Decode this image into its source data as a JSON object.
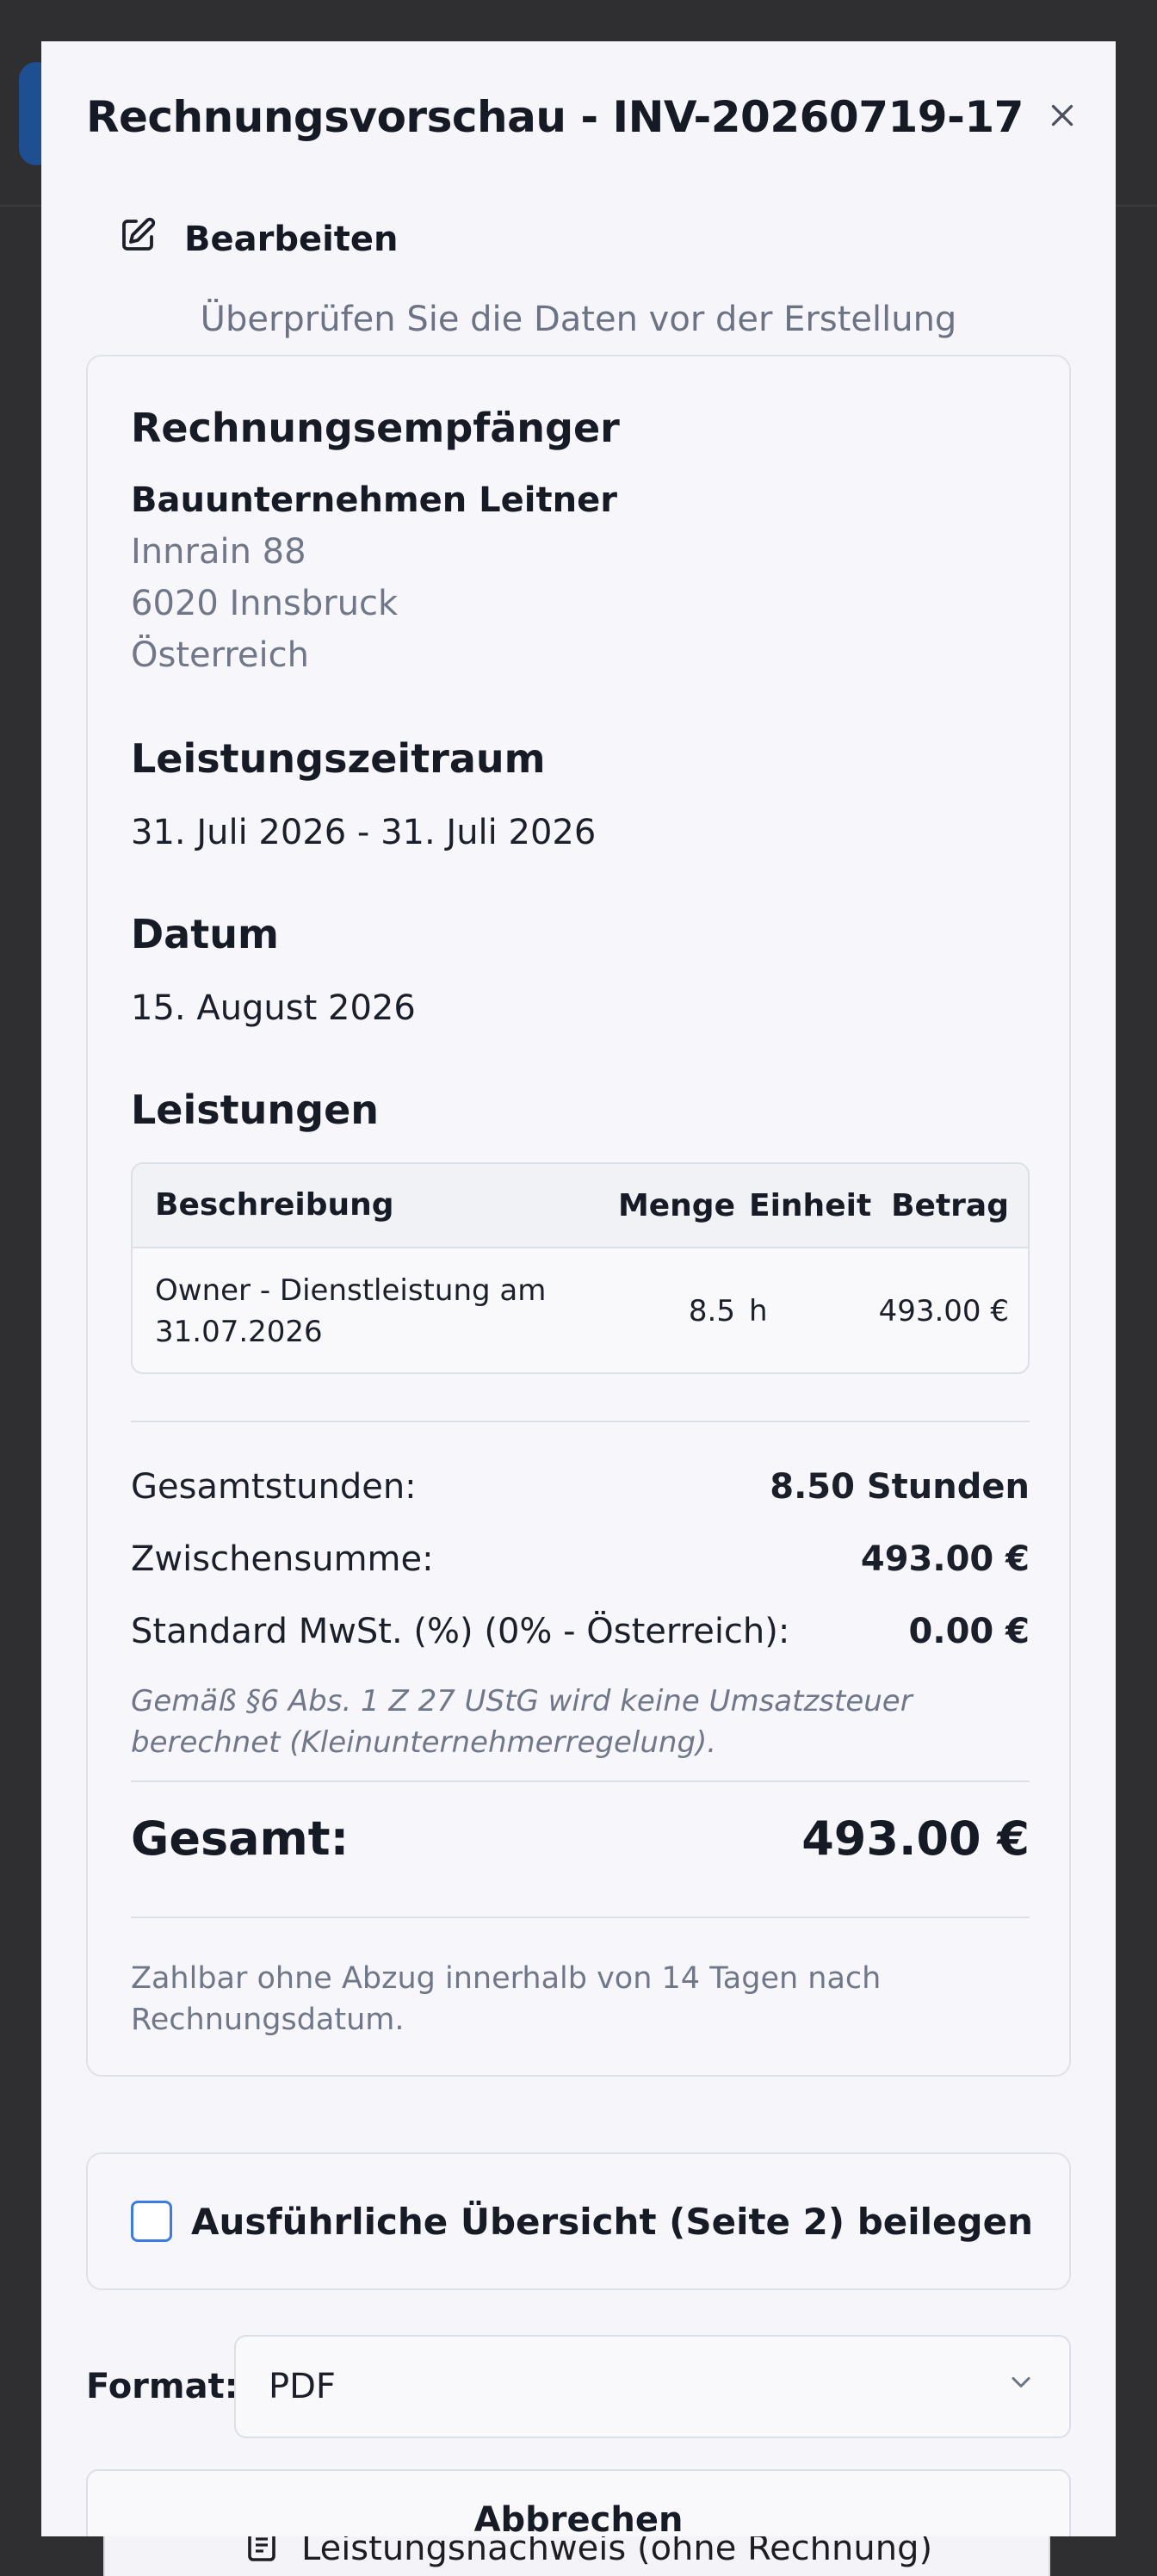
{
  "modal": {
    "title": "Rechnungsvorschau - INV-20260719-17",
    "edit_label": "Bearbeiten",
    "subtitle": "Überprüfen Sie die Daten vor der Erstellung"
  },
  "recipient": {
    "heading": "Rechnungsempfänger",
    "name": "Bauunternehmen Leitner",
    "street": "Innrain 88",
    "city": "6020 Innsbruck",
    "country": "Österreich"
  },
  "period": {
    "heading": "Leistungszeitraum",
    "value": "31. Juli 2026 - 31. Juli 2026"
  },
  "date": {
    "heading": "Datum",
    "value": "15. August 2026"
  },
  "services": {
    "heading": "Leistungen",
    "columns": {
      "description": "Beschreibung",
      "quantity": "Menge",
      "unit": "Einheit",
      "amount": "Betrag"
    },
    "rows": [
      {
        "description_line1": "Owner - Dienstleistung am",
        "description_line2": "31.07.2026",
        "quantity": "8.5",
        "unit": "h",
        "amount": "493.00 €"
      }
    ]
  },
  "summary": {
    "total_hours_label": "Gesamtstunden:",
    "total_hours_value": "8.50 Stunden",
    "subtotal_label": "Zwischensumme:",
    "subtotal_value": "493.00 €",
    "tax_label": "Standard MwSt. (%) (0% - Österreich):",
    "tax_value": "0.00 €",
    "tax_note": "Gemäß §6 Abs. 1 Z 27 UStG wird keine Umsatzsteuer berechnet (Kleinunternehmerregelung).",
    "total_label": "Gesamt:",
    "total_value": "493.00 €",
    "payment_note": "Zahlbar ohne Abzug innerhalb von 14 Tagen nach Rechnungsdatum."
  },
  "options": {
    "detail_checkbox_label": "Ausführliche Übersicht (Seite 2) beilegen",
    "detail_checked": false
  },
  "format": {
    "label": "Format:",
    "selected": "PDF"
  },
  "actions": {
    "cancel_label": "Abbrechen"
  },
  "background": {
    "bottom_item_label": "Leistungsnachweis (ohne Rechnung)"
  },
  "colors": {
    "accent": "#3c7ce0",
    "modal_bg": "#f6f6fa",
    "overlay": "#2f2f31"
  }
}
